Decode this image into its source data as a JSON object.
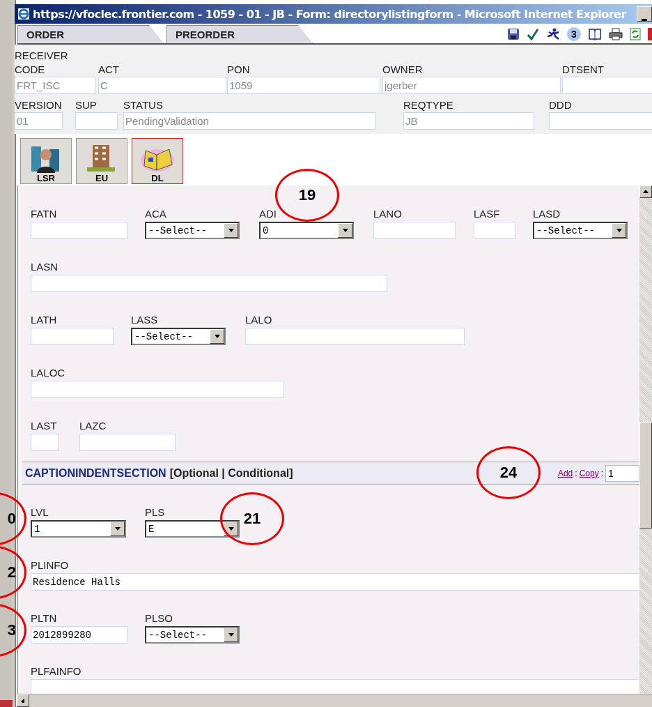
{
  "window": {
    "title": "https://vfoclec.frontier.com - 1059 - 01 - JB - Form: directorylistingform - Microsoft Internet Explorer"
  },
  "tabs": [
    {
      "label": "ORDER"
    },
    {
      "label": "PREORDER"
    }
  ],
  "toolbar": {
    "badge": "3"
  },
  "header_rows": [
    [
      {
        "label": "RECEIVER CODE",
        "value": "FRT_ISC",
        "disabled": true
      },
      {
        "label": "ACT",
        "value": "C",
        "disabled": true
      },
      {
        "label": "PON",
        "value": "1059",
        "disabled": true
      },
      {
        "label": "OWNER",
        "value": "jgerber",
        "disabled": true
      },
      {
        "label": "DTSENT"
      }
    ],
    [
      {
        "label": "VERSION",
        "value": "01",
        "disabled": true
      },
      {
        "label": "SUP"
      },
      {
        "label": "STATUS",
        "value": "PendingValidation",
        "disabled": true
      },
      {
        "label": "REQTYPE",
        "value": "JB",
        "disabled": true
      },
      {
        "label": "DDD"
      }
    ]
  ],
  "modules": [
    {
      "label": "LSR",
      "selected": false
    },
    {
      "label": "EU",
      "selected": false
    },
    {
      "label": "DL",
      "selected": true
    }
  ],
  "form_rows": [
    [
      {
        "label": "FATN",
        "kind": "text"
      },
      {
        "label": "ACA",
        "kind": "select",
        "value": "--Select--"
      },
      {
        "label": "ADI",
        "kind": "select",
        "value": "0"
      },
      {
        "label": "LANO",
        "kind": "text"
      },
      {
        "label": "LASF",
        "kind": "text"
      },
      {
        "label": "LASD",
        "kind": "select",
        "value": "--Select--"
      }
    ],
    [
      {
        "label": "LASN",
        "kind": "text"
      }
    ],
    [
      {
        "label": "LATH",
        "kind": "text"
      },
      {
        "label": "LASS",
        "kind": "select",
        "value": "--Select--"
      },
      {
        "label": "LALO",
        "kind": "text"
      }
    ],
    [
      {
        "label": "LALOC",
        "kind": "text"
      }
    ],
    [
      {
        "label": "LAST",
        "kind": "text"
      },
      {
        "label": "LAZC",
        "kind": "text"
      }
    ]
  ],
  "section": {
    "title": "CAPTIONINDENTSECTION",
    "tag": "[Optional | Conditional]",
    "add_link": "Add",
    "add_separator": ":",
    "copy_link": "Copy",
    "copy_separator": ":",
    "copy_count": "1"
  },
  "section_rows": [
    [
      {
        "label": "LVL",
        "kind": "select",
        "value": "1"
      },
      {
        "label": "PLS",
        "kind": "select",
        "value": "E"
      }
    ],
    [
      {
        "label": "PLINFO",
        "kind": "text",
        "value": "Residence Halls"
      }
    ],
    [
      {
        "label": "PLTN",
        "kind": "text",
        "value": "2012899280"
      },
      {
        "label": "PLSO",
        "kind": "select",
        "value": "--Select--"
      }
    ],
    [
      {
        "label": "PLFAINFO",
        "kind": "text"
      }
    ]
  ],
  "annotations": [
    "19",
    "24",
    "21",
    "0",
    "2",
    "3"
  ]
}
